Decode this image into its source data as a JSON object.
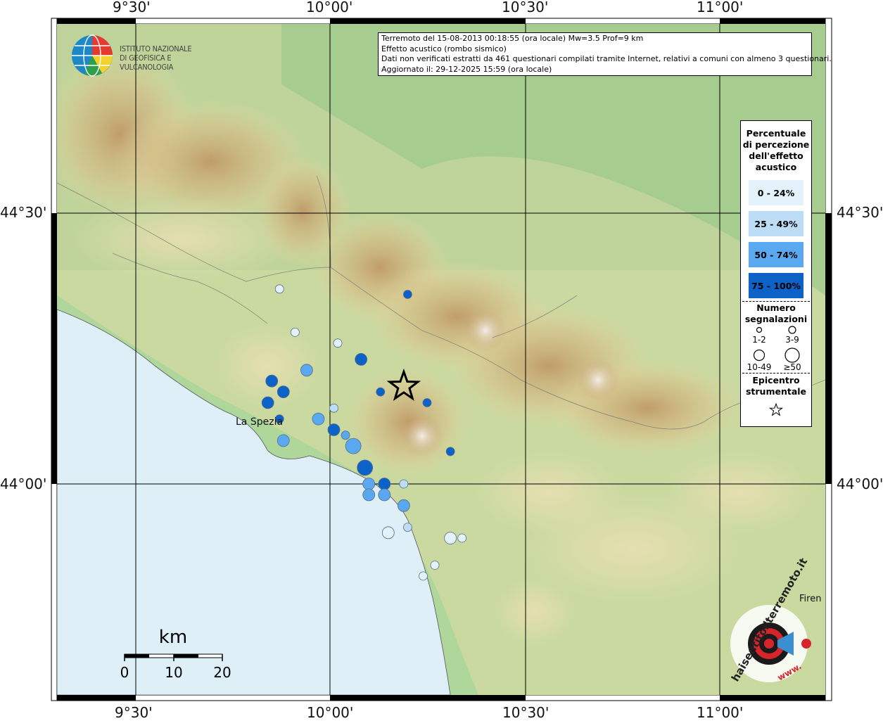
{
  "axes": {
    "top_lon": [
      "9°30'",
      "10°00'",
      "10°30'",
      "11°00'"
    ],
    "bottom_lon": [
      "9°30'",
      "10°00'",
      "10°30'",
      "11°00'"
    ],
    "left_lat": [
      "44°30'",
      "44°00'"
    ],
    "right_lat": [
      "44°30'",
      "44°00'"
    ]
  },
  "header": {
    "line1": "Terremoto del 15-08-2013 00:18:55 (ora locale) Mw=3.5 Prof=9 km",
    "line2": "Effetto acustico (rombo sismico)",
    "line3": "Dati non verificati estratti da 461 questionari compilati tramite Internet, relativi a comuni con almeno 3 questionari.",
    "line4": "Aggiornato il: 29-12-2025 15:59 (ora locale)"
  },
  "logo": {
    "line1": "ISTITUTO NAZIONALE",
    "line2": "DI GEOFISICA E VULCANOLOGIA"
  },
  "legend": {
    "title": [
      "Percentuale",
      "di percezione",
      "dell'effetto",
      "acustico"
    ],
    "classes": [
      {
        "label": "0 - 24%",
        "color": "#e4f3fb"
      },
      {
        "label": "25 - 49%",
        "color": "#bddcf6"
      },
      {
        "label": "50 - 74%",
        "color": "#5aa8ef"
      },
      {
        "label": "75 - 100%",
        "color": "#0d62c8"
      }
    ],
    "size_title": [
      "Numero",
      "segnalazioni"
    ],
    "sizes": [
      "1-2",
      "3-9",
      "10-49",
      "≥50"
    ],
    "epicenter_title": [
      "Epicentro",
      "strumentale"
    ]
  },
  "places": {
    "la_spezia": "La Spezia",
    "firenze": "Firen"
  },
  "scale": {
    "unit": "km",
    "ticks": [
      "0",
      "10",
      "20"
    ]
  },
  "badge": {
    "text": "haisentitoilterremoto.it",
    "www": "www."
  },
  "epicenter": {
    "lon": 10.19,
    "lat": 44.18
  },
  "points": [
    {
      "lon": 9.87,
      "lat": 44.36,
      "cls": 0,
      "n": 1
    },
    {
      "lon": 10.2,
      "lat": 44.35,
      "cls": 3,
      "n": 1
    },
    {
      "lon": 9.91,
      "lat": 44.28,
      "cls": 0,
      "n": 1
    },
    {
      "lon": 10.02,
      "lat": 44.26,
      "cls": 0,
      "n": 1
    },
    {
      "lon": 10.08,
      "lat": 44.23,
      "cls": 3,
      "n": 2
    },
    {
      "lon": 9.94,
      "lat": 44.21,
      "cls": 2,
      "n": 2
    },
    {
      "lon": 9.85,
      "lat": 44.19,
      "cls": 3,
      "n": 2
    },
    {
      "lon": 9.88,
      "lat": 44.17,
      "cls": 3,
      "n": 2
    },
    {
      "lon": 9.84,
      "lat": 44.15,
      "cls": 3,
      "n": 2
    },
    {
      "lon": 10.13,
      "lat": 44.17,
      "cls": 3,
      "n": 1
    },
    {
      "lon": 10.25,
      "lat": 44.15,
      "cls": 3,
      "n": 1
    },
    {
      "lon": 10.01,
      "lat": 44.14,
      "cls": 1,
      "n": 1
    },
    {
      "lon": 9.87,
      "lat": 44.12,
      "cls": 3,
      "n": 1
    },
    {
      "lon": 9.97,
      "lat": 44.12,
      "cls": 2,
      "n": 2
    },
    {
      "lon": 10.01,
      "lat": 44.1,
      "cls": 3,
      "n": 2
    },
    {
      "lon": 10.04,
      "lat": 44.09,
      "cls": 2,
      "n": 1
    },
    {
      "lon": 9.88,
      "lat": 44.08,
      "cls": 2,
      "n": 2
    },
    {
      "lon": 10.06,
      "lat": 44.07,
      "cls": 2,
      "n": 3
    },
    {
      "lon": 10.31,
      "lat": 44.06,
      "cls": 3,
      "n": 1
    },
    {
      "lon": 10.09,
      "lat": 44.03,
      "cls": 3,
      "n": 3
    },
    {
      "lon": 10.1,
      "lat": 44.0,
      "cls": 2,
      "n": 2
    },
    {
      "lon": 10.14,
      "lat": 44.0,
      "cls": 3,
      "n": 2
    },
    {
      "lon": 10.19,
      "lat": 44.0,
      "cls": 1,
      "n": 1
    },
    {
      "lon": 10.1,
      "lat": 43.98,
      "cls": 2,
      "n": 2
    },
    {
      "lon": 10.14,
      "lat": 43.98,
      "cls": 2,
      "n": 2
    },
    {
      "lon": 10.19,
      "lat": 43.96,
      "cls": 2,
      "n": 2
    },
    {
      "lon": 10.2,
      "lat": 43.92,
      "cls": 1,
      "n": 1
    },
    {
      "lon": 10.15,
      "lat": 43.91,
      "cls": 0,
      "n": 2
    },
    {
      "lon": 10.31,
      "lat": 43.9,
      "cls": 0,
      "n": 2
    },
    {
      "lon": 10.34,
      "lat": 43.9,
      "cls": 0,
      "n": 1
    },
    {
      "lon": 10.27,
      "lat": 43.85,
      "cls": 0,
      "n": 1
    },
    {
      "lon": 10.24,
      "lat": 43.83,
      "cls": 0,
      "n": 1
    }
  ]
}
